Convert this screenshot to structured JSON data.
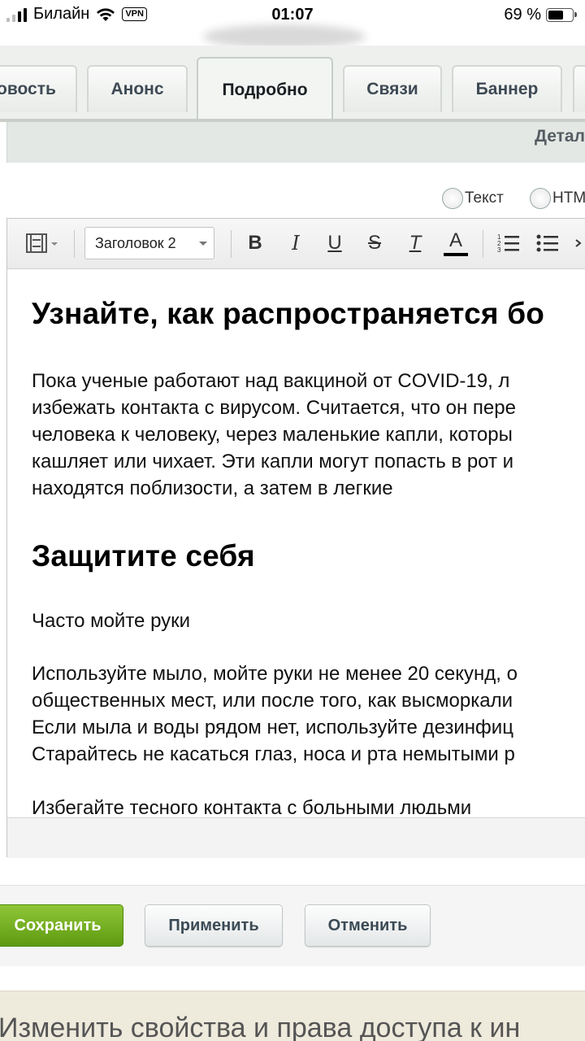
{
  "status_bar": {
    "carrier": "Билайн",
    "vpn": "VPN",
    "time": "01:07",
    "battery": "69 %"
  },
  "tabs": [
    {
      "label": "овость"
    },
    {
      "label": "Анонс"
    },
    {
      "label": "Подробно"
    },
    {
      "label": "Связи"
    },
    {
      "label": "Баннер"
    }
  ],
  "detail_title": "Детал",
  "mode_radios": [
    {
      "label": "Текст"
    },
    {
      "label": "HTM"
    }
  ],
  "toolbar": {
    "style_value": "Заголовок 2",
    "bold": "B",
    "italic": "I",
    "underline": "U",
    "strike": "S",
    "clear_format": "T",
    "font_color": "A"
  },
  "content": {
    "heading1": "Узнайте, как распространяется бо",
    "para1": [
      "Пока ученые работают над вакциной от COVID-19, л",
      "избежать контакта с вирусом. Считается, что он пере",
      "человека к человеку, через маленькие капли, которы",
      "кашляет или чихает. Эти капли могут попасть в рот и",
      "находятся поблизости, а затем в легкие"
    ],
    "heading2": "Защитите себя",
    "para2": "Часто мойте руки",
    "para3": [
      "Используйте мыло, мойте руки не менее 20 секунд, о",
      "общественных мест, или после того, как высморкали",
      "Если мыла и воды рядом нет, используйте дезинфиц",
      "Старайтесь не касаться глаз, носа и рта немытыми р"
    ],
    "para4": "Избегайте тесного контакта с больными людьми"
  },
  "buttons": {
    "save": "Сохранить",
    "apply": "Применить",
    "cancel": "Отменить"
  },
  "bottom_banner": "Изменить свойства и права доступа к ин"
}
